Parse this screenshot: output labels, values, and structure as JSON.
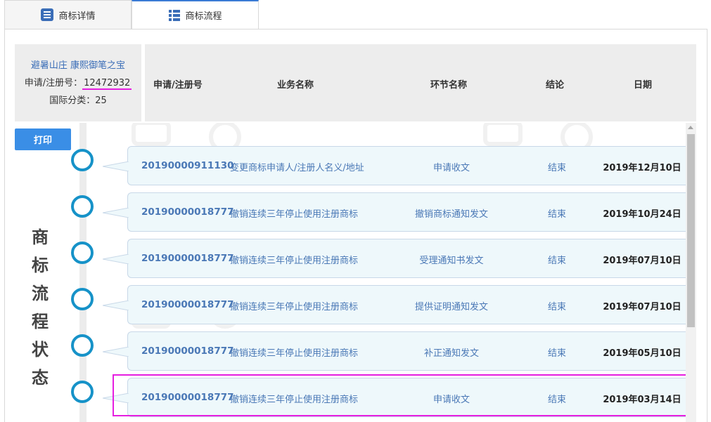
{
  "tabs": [
    {
      "label": "商标详情",
      "icon": "document-list-icon",
      "active": false
    },
    {
      "label": "商标流程",
      "icon": "grid-list-icon",
      "active": true
    }
  ],
  "trademark": {
    "name": "避暑山庄 康熙御笔之宝",
    "reg_label": "申请/注册号：",
    "reg_no": "12472932",
    "class_label": "国际分类：",
    "class_no": "25"
  },
  "table": {
    "headers": [
      "申请/注册号",
      "业务名称",
      "环节名称",
      "结论",
      "日期"
    ]
  },
  "print_label": "打印",
  "side_title": [
    "商",
    "标",
    "流",
    "程",
    "状",
    "态"
  ],
  "rows": [
    {
      "no": "20190000911130",
      "business": "变更商标申请人/注册人名义/地址",
      "step": "申请收文",
      "result": "结束",
      "date": "2019年12月10日"
    },
    {
      "no": "20190000018777",
      "business": "撤销连续三年停止使用注册商标",
      "step": "撤销商标通知发文",
      "result": "结束",
      "date": "2019年10月24日"
    },
    {
      "no": "20190000018777",
      "business": "撤销连续三年停止使用注册商标",
      "step": "受理通知书发文",
      "result": "结束",
      "date": "2019年07月10日"
    },
    {
      "no": "20190000018777",
      "business": "撤销连续三年停止使用注册商标",
      "step": "提供证明通知发文",
      "result": "结束",
      "date": "2019年07月10日"
    },
    {
      "no": "20190000018777",
      "business": "撤销连续三年停止使用注册商标",
      "step": "补正通知发文",
      "result": "结束",
      "date": "2019年05月10日"
    },
    {
      "no": "20190000018777",
      "business": "撤销连续三年停止使用注册商标",
      "step": "申请收文",
      "result": "结束",
      "date": "2019年03月14日"
    }
  ],
  "colors": {
    "accent": "#3a8ee6",
    "timeline_circle": "#1692c8",
    "row_bg": "#eef8fb",
    "link_text": "#4a78b6",
    "highlight": "#e61ee0"
  }
}
